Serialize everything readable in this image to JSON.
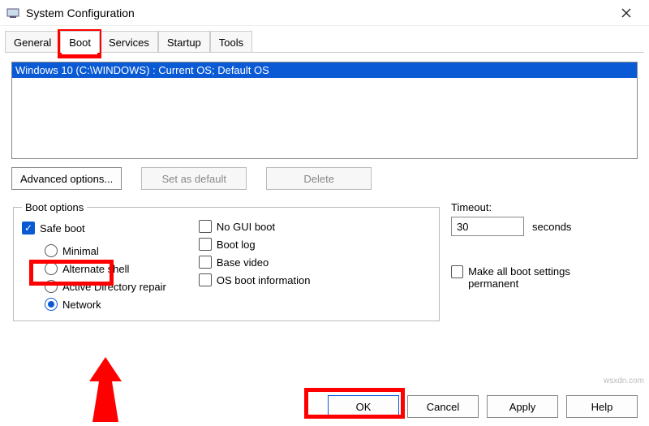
{
  "window": {
    "title": "System Configuration"
  },
  "tabs": {
    "items": [
      {
        "label": "General"
      },
      {
        "label": "Boot"
      },
      {
        "label": "Services"
      },
      {
        "label": "Startup"
      },
      {
        "label": "Tools"
      }
    ],
    "active_index": 1
  },
  "os_list": {
    "selected": "Windows 10 (C:\\WINDOWS) : Current OS; Default OS"
  },
  "buttons_row": {
    "advanced": "Advanced options...",
    "set_default": "Set as default",
    "delete": "Delete"
  },
  "boot_options": {
    "legend": "Boot options",
    "safe_boot": {
      "label": "Safe boot",
      "checked": true
    },
    "modes": {
      "minimal": "Minimal",
      "altshell": "Alternate shell",
      "adrepair": "Active Directory repair",
      "network": "Network",
      "selected": "network"
    },
    "flags": {
      "nogui": {
        "label": "No GUI boot",
        "checked": false
      },
      "bootlog": {
        "label": "Boot log",
        "checked": false
      },
      "basevideo": {
        "label": "Base video",
        "checked": false
      },
      "osinfo": {
        "label": "OS boot information",
        "checked": false
      }
    }
  },
  "timeout": {
    "label": "Timeout:",
    "value": "30",
    "unit": "seconds"
  },
  "permanent": {
    "label": "Make all boot settings permanent",
    "checked": false
  },
  "footer": {
    "ok": "OK",
    "cancel": "Cancel",
    "apply": "Apply",
    "help": "Help"
  },
  "watermark": "wsxdn.com"
}
